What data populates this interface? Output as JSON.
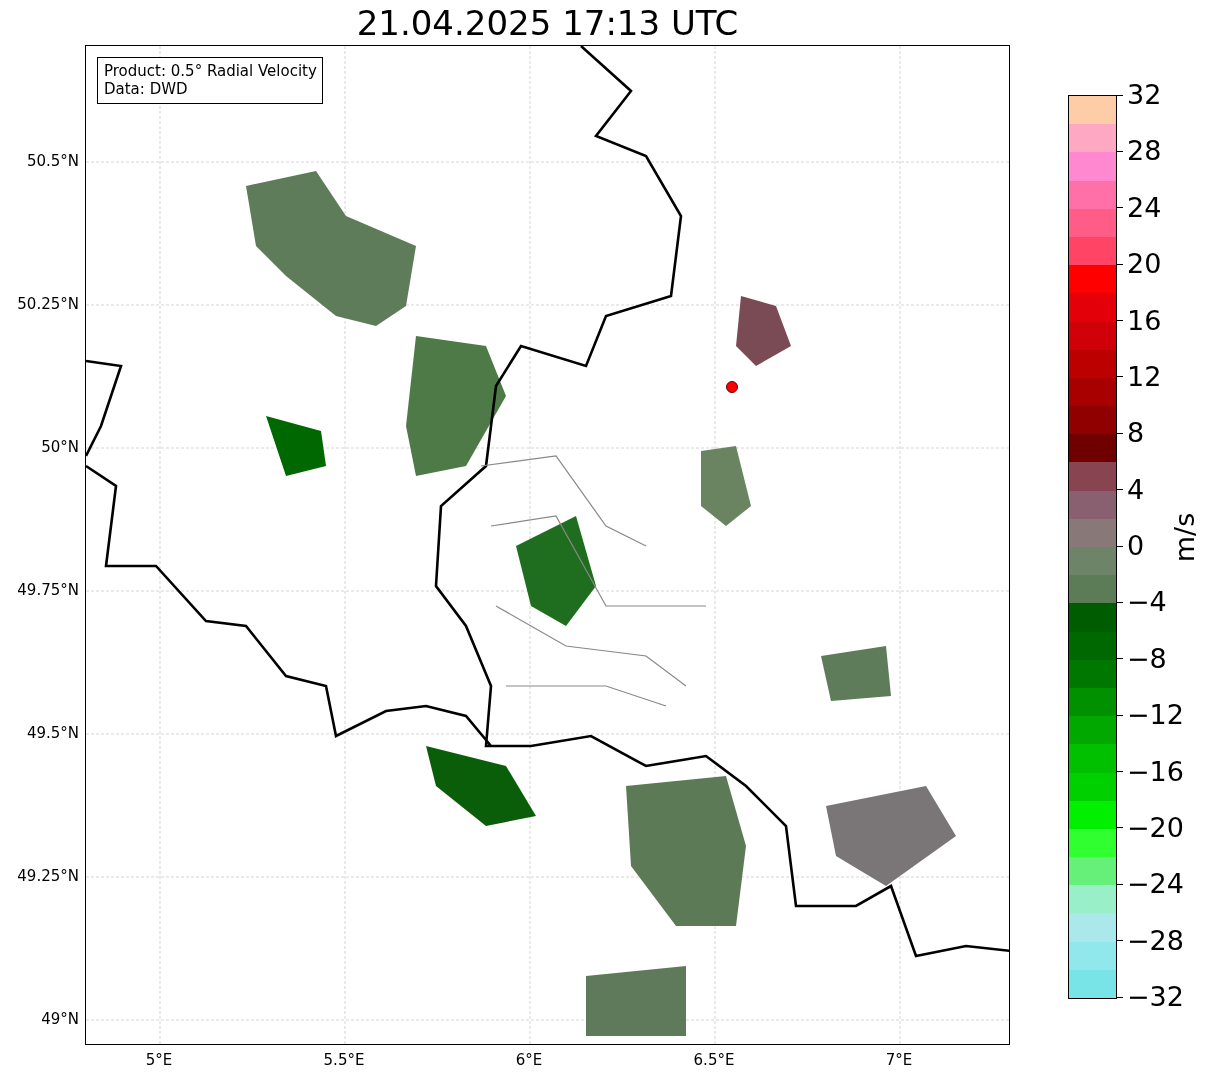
{
  "title": "21.04.2025 17:13 UTC",
  "legend": {
    "lines": [
      "Product: 0.5° Radial Velocity",
      "Data: DWD"
    ]
  },
  "map": {
    "lat_labels": [
      "50.5°N",
      "50.25°N",
      "50°N",
      "49.75°N",
      "49.5°N",
      "49.25°N",
      "49°N"
    ],
    "lon_labels": [
      "5°E",
      "5.5°E",
      "6°E",
      "6.5°E",
      "7°E"
    ]
  },
  "colorbar": {
    "label": "m/s",
    "ticks": [
      "32",
      "28",
      "24",
      "20",
      "16",
      "12",
      "8",
      "4",
      "0",
      "−4",
      "−8",
      "−12",
      "−16",
      "−20",
      "−24",
      "−28",
      "−32"
    ],
    "segments": [
      {
        "color": "#ffcca8"
      },
      {
        "color": "#ffa8c4"
      },
      {
        "color": "#ff88d0"
      },
      {
        "color": "#ff70a8"
      },
      {
        "color": "#ff5c88"
      },
      {
        "color": "#ff4466"
      },
      {
        "color": "#ff0000"
      },
      {
        "color": "#e40008"
      },
      {
        "color": "#d00008"
      },
      {
        "color": "#bc0000"
      },
      {
        "color": "#a80000"
      },
      {
        "color": "#900000"
      },
      {
        "color": "#700000"
      },
      {
        "color": "#884450"
      },
      {
        "color": "#886070"
      },
      {
        "color": "#887878"
      },
      {
        "color": "#6e8468"
      },
      {
        "color": "#5c7c58"
      },
      {
        "color": "#005c00"
      },
      {
        "color": "#006800"
      },
      {
        "color": "#007800"
      },
      {
        "color": "#009000"
      },
      {
        "color": "#00a800"
      },
      {
        "color": "#00c000"
      },
      {
        "color": "#00d000"
      },
      {
        "color": "#00f000"
      },
      {
        "color": "#30ff30"
      },
      {
        "color": "#66f07a"
      },
      {
        "color": "#99f0c8"
      },
      {
        "color": "#aae8ec"
      },
      {
        "color": "#90e8ec"
      },
      {
        "color": "#78e4e8"
      }
    ]
  }
}
